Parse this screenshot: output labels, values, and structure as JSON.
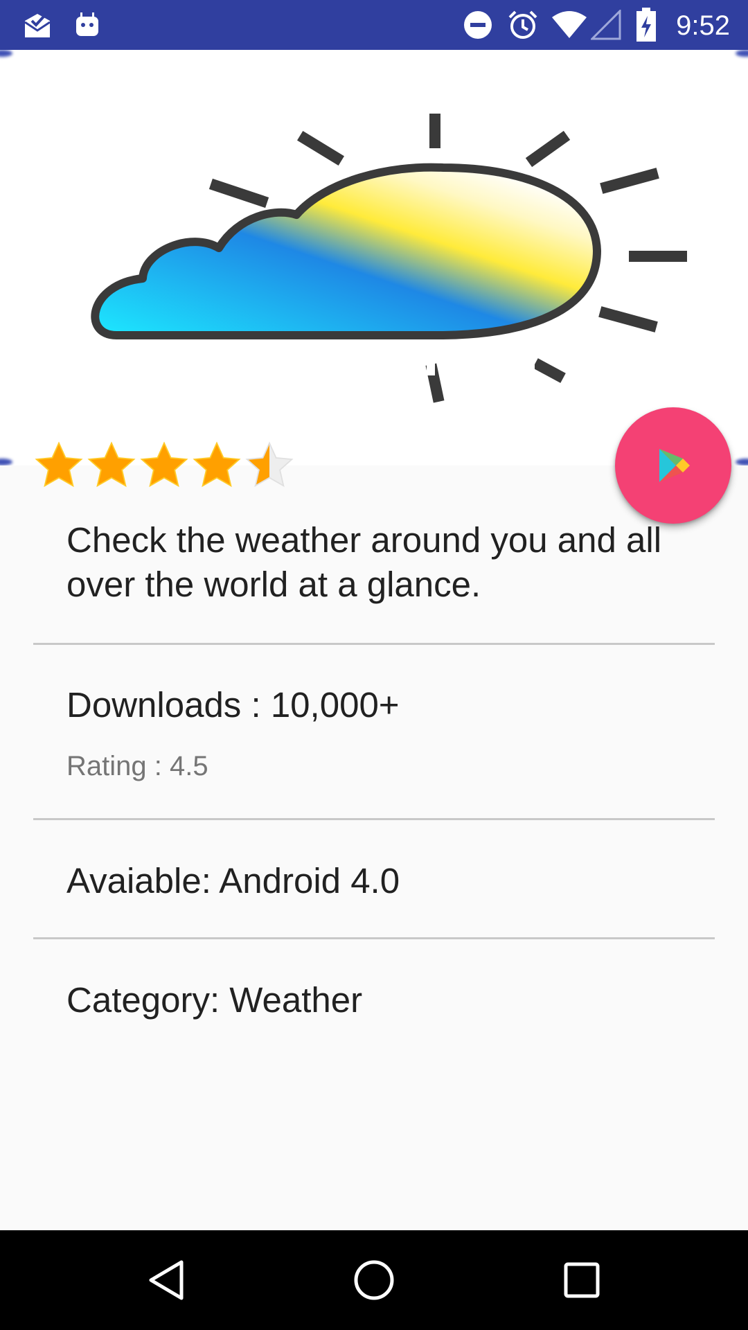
{
  "status_bar": {
    "time": "9:52",
    "icons": [
      "mail-check-icon",
      "android-icon",
      "do-not-disturb-icon",
      "alarm-icon",
      "wifi-icon",
      "signal-icon",
      "battery-charging-icon"
    ],
    "background_color": "#303f9f"
  },
  "app": {
    "logo_icon": "weather-cloud-sun-icon",
    "rating_value": 4.5,
    "rating_max": 5,
    "description": "Check the weather around you and all over the world at a glance.",
    "downloads": "Downloads : 10,000+",
    "rating_text": "Rating : 4.5",
    "available": "Avaiable: Android 4.0",
    "category": "Category: Weather"
  },
  "fab": {
    "icon": "play-store-icon",
    "color": "#f44174"
  },
  "nav_bar": {
    "buttons": [
      "back-icon",
      "home-icon",
      "recents-icon"
    ]
  }
}
